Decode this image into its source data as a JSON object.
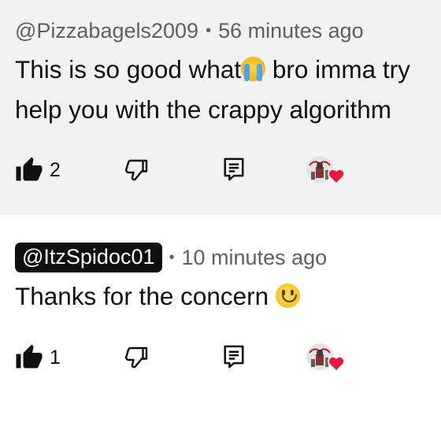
{
  "comments": [
    {
      "author": "@Pizzabagels2009",
      "separator": "•",
      "time": "56 minutes ago",
      "author_highlighted": false,
      "text_line1": "This is so good what",
      "text_line1_rest": " bro imma try",
      "text_line2": "help you with the crappy algorithm",
      "emoji": "loudly-crying-face",
      "like_count": "2",
      "liked": true
    },
    {
      "author": "@ItzSpidoc01",
      "separator": "•",
      "time": "10 minutes ago",
      "author_highlighted": true,
      "text_line1": "Thanks for the concern ",
      "emoji": "slightly-smiling-face",
      "like_count": "1",
      "liked": true
    }
  ],
  "icons": {
    "like": "thumbs-up-filled-icon",
    "dislike": "thumbs-down-outline-icon",
    "reply": "reply-comment-icon",
    "creator_heart": "creator-heart-icon"
  },
  "colors": {
    "first_comment_bg": "#f2f2f2",
    "second_comment_bg": "#ffffff",
    "text": "#0f0f0f",
    "meta": "#606060",
    "author_pill_bg": "#0f0f0f",
    "heart": "#e8173b"
  }
}
